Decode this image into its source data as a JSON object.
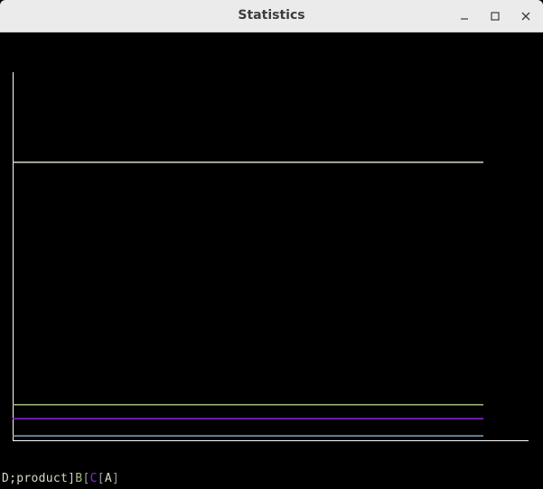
{
  "window": {
    "title": "Statistics"
  },
  "icons": {
    "minimize": "minimize-icon",
    "maximize": "maximize-icon",
    "close": "close-icon"
  },
  "colors": {
    "background": "#000000",
    "axis": "#ffffff",
    "series_b": "#a7c080",
    "series_c": "#8a2be2",
    "series_a": "#d8d8c8",
    "series_d": "#7fa7c8"
  },
  "statusbar": {
    "segments": [
      {
        "text": "D",
        "color": "#d8d8c8"
      },
      {
        "text": ";product",
        "color": "#d8d8c8"
      },
      {
        "text": "]",
        "color": "#d8d8c8"
      },
      {
        "text": "B",
        "color": "#a7c080"
      },
      {
        "text": "[",
        "color": "#a0a0a0"
      },
      {
        "text": "C",
        "color": "#8a2be2"
      },
      {
        "text": "[",
        "color": "#a0a0a0"
      },
      {
        "text": "A",
        "color": "#d8d8c8"
      },
      {
        "text": "]",
        "color": "#a0a0a0"
      }
    ]
  },
  "chart_data": {
    "type": "line",
    "series": [
      {
        "values": [
          4,
          4
        ],
        "color": "#d8d8c8"
      },
      {
        "values": [
          0.5,
          0.5
        ],
        "color": "#a7c080"
      },
      {
        "values": [
          0.3,
          0.3
        ],
        "color": "#8a2be2"
      },
      {
        "values": [
          0.05,
          0.05
        ],
        "color": "#7fa7c8"
      }
    ],
    "x": [
      0,
      1
    ],
    "ylim": [
      0,
      5.3
    ],
    "grid": false
  }
}
